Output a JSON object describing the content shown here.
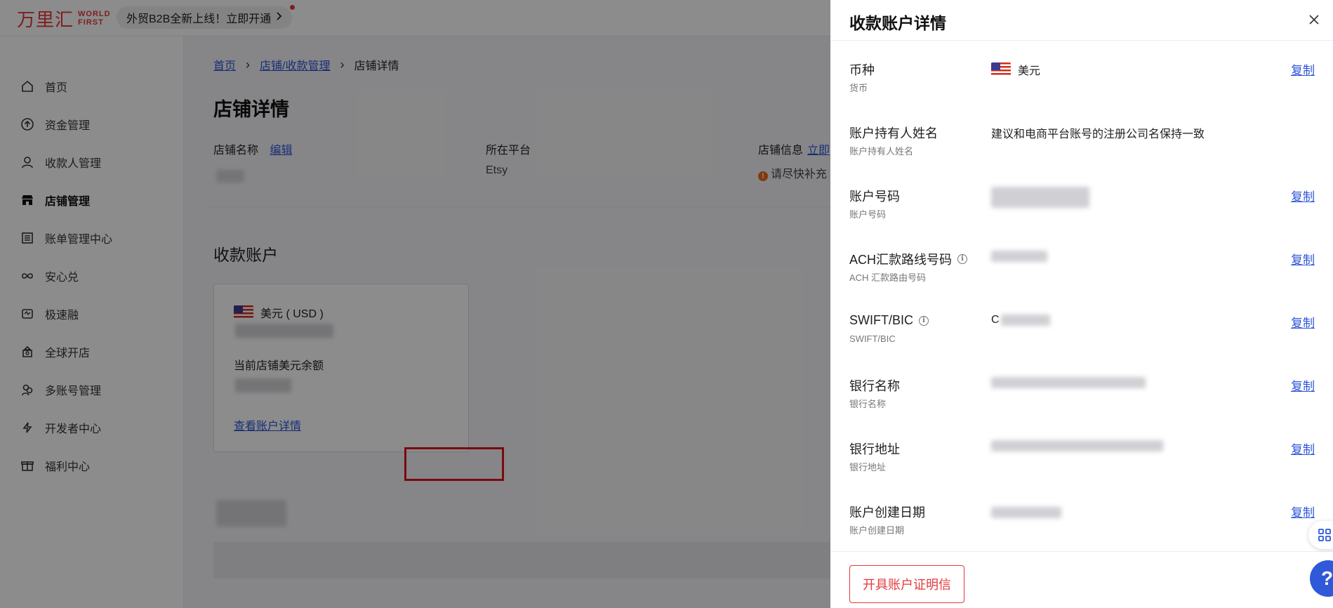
{
  "brand": {
    "name_cn": "万里汇",
    "name_en_line1": "WORLD",
    "name_en_line2": "FIRST",
    "color": "#e4393c"
  },
  "promo": {
    "text": "外贸B2B全新上线！立即开通"
  },
  "sidebar": {
    "items": [
      {
        "label": "首页",
        "icon": "home-icon"
      },
      {
        "label": "资金管理",
        "icon": "upload-circle-icon"
      },
      {
        "label": "收款人管理",
        "icon": "user-icon"
      },
      {
        "label": "店铺管理",
        "icon": "store-icon",
        "active": true
      },
      {
        "label": "账单管理中心",
        "icon": "bill-icon"
      },
      {
        "label": "安心兑",
        "icon": "exchange-icon"
      },
      {
        "label": "极速融",
        "icon": "finance-icon"
      },
      {
        "label": "全球开店",
        "icon": "global-store-icon"
      },
      {
        "label": "多账号管理",
        "icon": "multi-account-icon"
      },
      {
        "label": "开发者中心",
        "icon": "developer-icon"
      },
      {
        "label": "福利中心",
        "icon": "gift-icon"
      }
    ]
  },
  "breadcrumb": {
    "home": "首页",
    "section": "店铺/收款管理",
    "current": "店铺详情"
  },
  "page": {
    "title": "店铺详情",
    "store_name_label": "店铺名称",
    "edit_label": "编辑",
    "platform_label": "所在平台",
    "platform_value": "Etsy",
    "store_info_label": "店铺信息",
    "store_info_link": "立即",
    "store_info_warning": "请尽快补充"
  },
  "accounts": {
    "section_title": "收款账户",
    "card": {
      "currency": "美元 ( USD )",
      "balance_label": "当前店铺美元余额",
      "detail_link": "查看账户详情"
    }
  },
  "drawer": {
    "title": "收款账户详情",
    "rows": [
      {
        "label": "币种",
        "sub": "货币",
        "value": "美元",
        "flag": true,
        "copy": "复制"
      },
      {
        "label": "账户持有人姓名",
        "sub": "账户持有人姓名",
        "value": "建议和电商平台账号的注册公司名保持一致"
      },
      {
        "label": "账户号码",
        "sub": "账户号码",
        "copy": "复制"
      },
      {
        "label": "ACH汇款路线号码",
        "sub": "ACH 汇款路由号码",
        "info": true,
        "copy": "复制"
      },
      {
        "label": "SWIFT/BIC",
        "sub": "SWIFT/BIC",
        "info": true,
        "value": "C",
        "copy": "复制"
      },
      {
        "label": "银行名称",
        "sub": "银行名称",
        "copy": "复制"
      },
      {
        "label": "银行地址",
        "sub": "银行地址",
        "copy": "复制"
      },
      {
        "label": "账户创建日期",
        "sub": "账户创建日期",
        "copy": "复制"
      }
    ],
    "footer_button": "开具账户证明信"
  },
  "float": {
    "help": "?"
  }
}
